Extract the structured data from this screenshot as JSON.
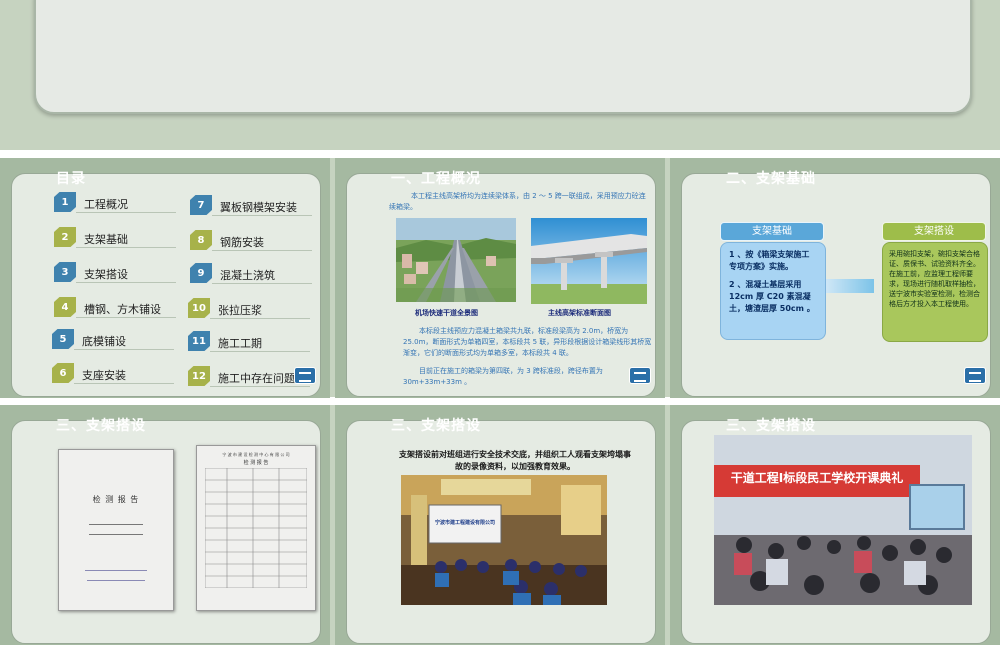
{
  "slides": {
    "toc": {
      "title": "目录",
      "items": [
        {
          "num": "1",
          "label": "工程概况"
        },
        {
          "num": "2",
          "label": "支架基础"
        },
        {
          "num": "3",
          "label": "支架搭设"
        },
        {
          "num": "4",
          "label": "槽钢、方木铺设"
        },
        {
          "num": "5",
          "label": "底模铺设"
        },
        {
          "num": "6",
          "label": "支座安装"
        },
        {
          "num": "7",
          "label": "翼板钢模架安装"
        },
        {
          "num": "8",
          "label": "钢筋安装"
        },
        {
          "num": "9",
          "label": "混凝土浇筑"
        },
        {
          "num": "10",
          "label": "张拉压浆"
        },
        {
          "num": "11",
          "label": "施工工期"
        },
        {
          "num": "12",
          "label": "施工中存在问题"
        }
      ]
    },
    "overview": {
      "title": "一、工程概况",
      "intro": "本工程主线高架桥均为连续梁体系，由 2 ～ 5 跨一联组成，采用预应力砼连续箱梁。",
      "caption_left": "机场快速干道全景图",
      "caption_right": "主线高架标准断面图",
      "body1": "本标段主线预应力混凝土箱梁共九联，标准段梁高为 2.0m，桥宽为 25.0m，断面形式为单箱四室，本标段共 5 联，异形段根据设计箱梁线形其桥宽渐变，它们的断面形式均为单箱多室，本标段共 4 联。",
      "body2": "目前正在施工的箱梁为第四联，为 3 跨标准段，跨径布置为 30m+33m+33m 。"
    },
    "foundation": {
      "title": "二、支架基础",
      "tag_left": "支架基础",
      "tag_right": "支架搭设",
      "blue_text_1": "1 、按《箱梁支架施工专项方案》实施。",
      "blue_text_2": "2 、混凝土基层采用 12cm 厚 C20 素混凝土，塘渣层厚 50cm 。",
      "green_text": "采用碗扣支架，碗扣支架合格证、质保书、试验资料齐全。在施工前，应监理工程师要求，现场进行随机取样抽检，送宁波市实验室检测，检测合格后方才投入本工程使用。"
    },
    "scaffold_docs": {
      "title": "三、支架搭设",
      "doc1_title": "检 测 报 告",
      "doc2_header": "宁 波 市 建 设 检 测 中 心 有 限 公 司",
      "doc2_title": "检 测 报 告"
    },
    "scaffold_meeting": {
      "title": "三、支架搭设",
      "notice": "支架搭设前对班组进行安全技术交底，并组织工人观看支架垮塌事故的录像资料，以加强教育效果。",
      "screen_text": "宁波市建工程建设有限公司"
    },
    "scaffold_school": {
      "title": "三、支架搭设",
      "banner": "干道工程Ⅰ标段民工学校开课典礼"
    }
  },
  "colors": {
    "background": "#c6d3c0",
    "slide_bg": "#a5b9a1",
    "panel": "#e5ebe3",
    "accent_blue": "#3f82ae",
    "accent_green": "#a7b24a",
    "text_blue": "#3575b5"
  }
}
